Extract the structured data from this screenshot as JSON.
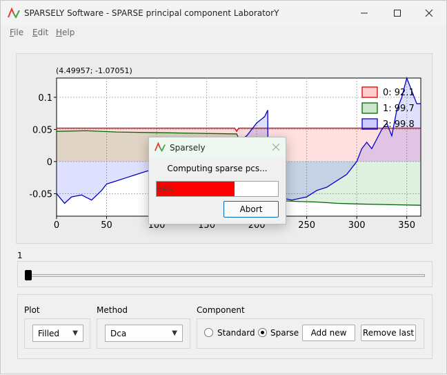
{
  "window": {
    "title": "SPARSELY Software - SPARSE principal component LaboratorY"
  },
  "menu": {
    "file": {
      "first": "F",
      "rest": "ile"
    },
    "edit": {
      "first": "E",
      "rest": "dit"
    },
    "help": {
      "first": "H",
      "rest": "elp"
    }
  },
  "plot": {
    "coordinate_readout": "(4.49957; -1.07051)"
  },
  "chart_data": {
    "type": "area",
    "x_range": [
      0,
      364
    ],
    "y_range": [
      -0.085,
      0.13
    ],
    "x_ticks": [
      "0",
      "50",
      "100",
      "150",
      "200",
      "250",
      "300",
      "350"
    ],
    "y_ticks": [
      "0.1",
      "0.05",
      "0",
      "-0.05"
    ],
    "grid": true,
    "legend_position": "top-right",
    "series": [
      {
        "name": "0: 92.1",
        "color": "#dd0000",
        "fill": "rgba(255,0,0,0.12)",
        "x": [
          0,
          40,
          80,
          120,
          170,
          178,
          180,
          182,
          200,
          210,
          260,
          300,
          364
        ],
        "y": [
          0.052,
          0.052,
          0.052,
          0.052,
          0.052,
          0.052,
          0.047,
          0.052,
          0.052,
          0.052,
          0.052,
          0.052,
          0.052
        ]
      },
      {
        "name": "1: 99.7",
        "color": "#006600",
        "fill": "rgba(0,128,0,0.12)",
        "x": [
          0,
          30,
          60,
          100,
          140,
          180,
          210,
          240,
          260,
          280,
          300,
          330,
          364
        ],
        "y": [
          0.047,
          0.048,
          0.046,
          0.045,
          0.044,
          0.043,
          -0.06,
          -0.062,
          -0.063,
          -0.065,
          -0.066,
          -0.067,
          -0.068
        ]
      },
      {
        "name": "2: 99.8",
        "color": "#0000cc",
        "fill": "rgba(0,0,255,0.12)",
        "x": [
          0,
          8,
          15,
          25,
          35,
          45,
          50,
          60,
          70,
          80,
          90,
          100,
          115,
          130,
          145,
          160,
          170,
          180,
          190,
          200,
          208,
          211,
          211.5,
          220,
          235,
          250,
          260,
          270,
          280,
          290,
          300,
          305,
          310,
          315,
          320,
          325,
          330,
          335,
          340,
          345,
          350,
          355,
          360,
          364
        ],
        "y": [
          -0.05,
          -0.065,
          -0.055,
          -0.052,
          -0.06,
          -0.045,
          -0.035,
          -0.03,
          -0.025,
          -0.02,
          -0.015,
          -0.012,
          -0.01,
          0.002,
          0.008,
          0.012,
          0.02,
          0.03,
          0.04,
          0.06,
          0.07,
          0.08,
          -0.05,
          -0.055,
          -0.06,
          -0.055,
          -0.045,
          -0.04,
          -0.03,
          -0.02,
          0.0,
          0.02,
          0.03,
          0.02,
          0.035,
          0.05,
          0.06,
          0.04,
          0.08,
          0.1,
          0.13,
          0.11,
          0.09,
          0.09
        ]
      }
    ]
  },
  "slider": {
    "value_label": "1",
    "position_fraction": 0.0
  },
  "controls": {
    "plot_label": "Plot",
    "plot_value": "Filled",
    "method_label": "Method",
    "method_value": "Dca",
    "component_label": "Component",
    "standard_label": "Standard",
    "sparse_label": "Sparse",
    "selected_component": "Sparse",
    "add_new": "Add new",
    "remove_last": "Remove last"
  },
  "dialog": {
    "title": "Sparsely",
    "message": "Computing sparse pcs...",
    "progress_percent": 64,
    "progress_text": "64%",
    "abort": "Abort"
  },
  "colors": {
    "accent_red": "#ff0000",
    "app_icon_red": "#e53935",
    "app_icon_green": "#43a047"
  }
}
